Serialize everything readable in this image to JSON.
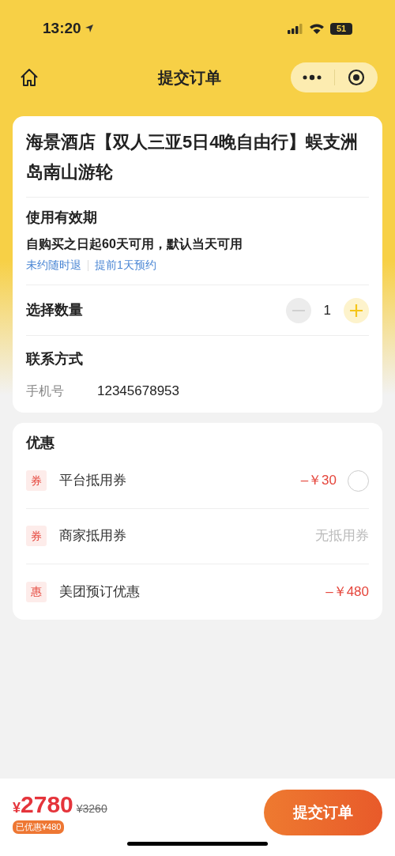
{
  "status_bar": {
    "time": "13:20",
    "battery": "51"
  },
  "nav": {
    "title": "提交订单"
  },
  "product": {
    "title": "海景酒店【双人三亚5日4晚自由行】蜈支洲岛南山游轮",
    "validity_heading": "使用有效期",
    "validity_text": "自购买之日起60天可用，默认当天可用",
    "tags": [
      "未约随时退",
      "提前1天预约"
    ]
  },
  "quantity": {
    "label": "选择数量",
    "value": "1",
    "minus_disabled": true,
    "plus_disabled": false
  },
  "contact": {
    "heading": "联系方式",
    "field_label": "手机号",
    "value": "12345678953"
  },
  "discounts": {
    "heading": "优惠",
    "items": [
      {
        "kind": "coupon",
        "badge": "券",
        "label": "平台抵用券",
        "amount": "–￥30",
        "selected": false
      },
      {
        "kind": "none",
        "badge": "券",
        "label": "商家抵用券",
        "amount": "无抵用券"
      },
      {
        "kind": "discount",
        "badge": "惠",
        "label": "美团预订优惠",
        "amount": "–￥480"
      }
    ]
  },
  "footer": {
    "currency": "¥",
    "price": "2780",
    "original_price": "¥3260",
    "saved": "已优惠¥480",
    "submit": "提交订单"
  }
}
